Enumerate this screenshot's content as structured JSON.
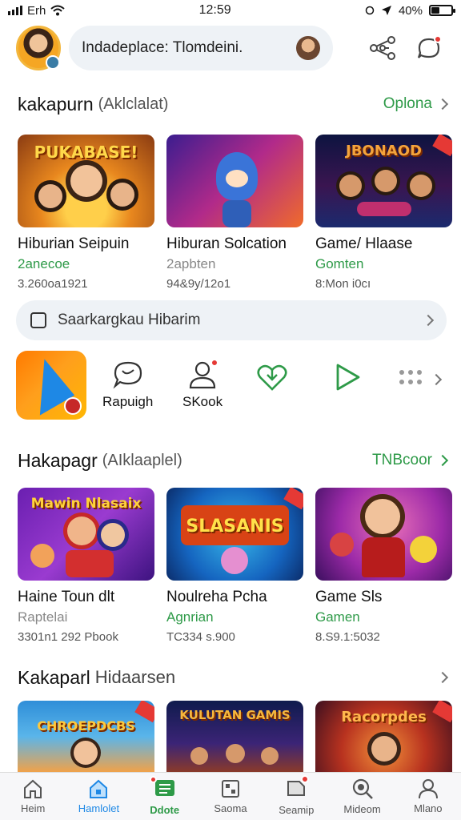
{
  "status_bar": {
    "carrier": "Erh",
    "time": "12:59",
    "battery": "40%",
    "battery_level": 0.4
  },
  "top_bar": {
    "search_text": "Indadeplace: Tlomdeini."
  },
  "section1": {
    "title": "kakapurn",
    "subtitle": "(Aklclalat)",
    "more_label": "Oplona",
    "cards": [
      {
        "banner": "PUKABASE!",
        "name": "Hiburian Seipuin",
        "category": "2anecoe",
        "meta": "3.260oa1921"
      },
      {
        "banner": "",
        "name": "Hiburan Solcation",
        "category": "2apbten",
        "meta": "94&9y/12o1"
      },
      {
        "banner": "JBONAOD",
        "name": "Game/ Hlaase",
        "category": "Gomten",
        "meta": "8:Mon i0cı"
      }
    ]
  },
  "search_bar": {
    "text": "Saarkargkau Hibarim"
  },
  "quick_actions": {
    "items": [
      {
        "label": "Rapuigh",
        "icon": "chat-bubble-icon"
      },
      {
        "label": "SKook",
        "icon": "person-icon"
      },
      {
        "label": "",
        "icon": "heart-download-icon"
      },
      {
        "label": "",
        "icon": "play-icon"
      },
      {
        "label": "",
        "icon": "more-dots-icon"
      }
    ]
  },
  "section2": {
    "title": "Hakapagr",
    "subtitle": "(AIklaaplel)",
    "more_label": "TNBcoor",
    "cards": [
      {
        "banner": "Mawin Nlasaix",
        "name": "Haine Toun dlt",
        "category": "Raptelai",
        "meta": "3301n1 292 Pbook"
      },
      {
        "banner": "SLASANIS",
        "name": "Noulreha Pcha",
        "category": "Agnrian",
        "meta": "TC334 s.900"
      },
      {
        "banner": "",
        "name": "Game Sls",
        "category": "Gamen",
        "meta": "8.S9.1:5032"
      }
    ]
  },
  "section3": {
    "title": "Kakaparl",
    "subtitle": "Hidaarsen",
    "cards": [
      {
        "banner": "CHROEPDCBS"
      },
      {
        "banner": "KULUTAN GAMIS"
      },
      {
        "banner": "Racorpdes"
      }
    ]
  },
  "bottom_nav": [
    {
      "label": "Heim",
      "icon": "home-icon"
    },
    {
      "label": "Hamlolet",
      "icon": "home-active-icon"
    },
    {
      "label": "Ddote",
      "icon": "list-icon"
    },
    {
      "label": "Saoma",
      "icon": "grid-icon"
    },
    {
      "label": "Seamip",
      "icon": "tag-icon"
    },
    {
      "label": "Mideom",
      "icon": "search-icon"
    },
    {
      "label": "Mlano",
      "icon": "profile-icon"
    }
  ],
  "colors": {
    "accent_green": "#2e9a48",
    "accent_blue": "#1e88e5",
    "badge_red": "#e53935"
  }
}
